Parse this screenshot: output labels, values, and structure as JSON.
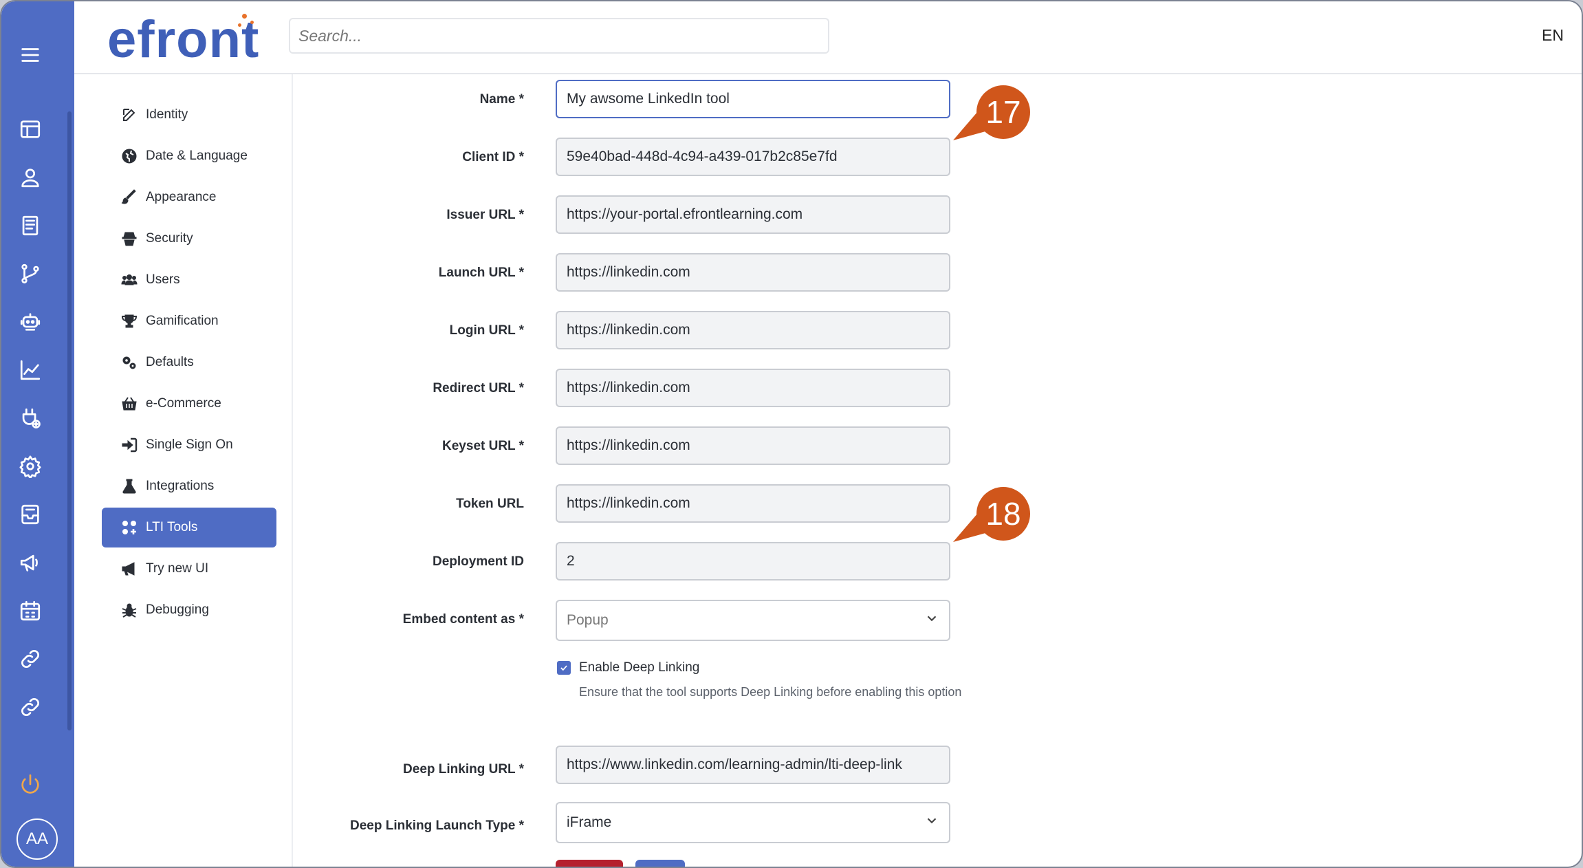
{
  "header": {
    "logo_text": "efront",
    "search_placeholder": "Search...",
    "language": "EN"
  },
  "user": {
    "initials": "AA"
  },
  "rail_icons": [
    "menu-icon",
    "dashboard-icon",
    "user-icon",
    "courses-icon",
    "branches-icon",
    "robot-icon",
    "reports-icon",
    "plugin-icon",
    "settings-icon",
    "messages-icon",
    "announcements-icon",
    "calendar-icon",
    "link-icon",
    "link-icon",
    "power-icon"
  ],
  "sidebar": {
    "items": [
      {
        "label": "Identity",
        "icon": "edit-icon"
      },
      {
        "label": "Date & Language",
        "icon": "globe-icon"
      },
      {
        "label": "Appearance",
        "icon": "brush-icon"
      },
      {
        "label": "Security",
        "icon": "spy-icon"
      },
      {
        "label": "Users",
        "icon": "users-icon"
      },
      {
        "label": "Gamification",
        "icon": "trophy-icon"
      },
      {
        "label": "Defaults",
        "icon": "cogs-icon"
      },
      {
        "label": "e-Commerce",
        "icon": "basket-icon"
      },
      {
        "label": "Single Sign On",
        "icon": "sign-in-icon"
      },
      {
        "label": "Integrations",
        "icon": "flask-icon"
      },
      {
        "label": "LTI Tools",
        "icon": "lti-icon"
      },
      {
        "label": "Try new UI",
        "icon": "megaphone-icon"
      },
      {
        "label": "Debugging",
        "icon": "bug-icon"
      }
    ],
    "active": "LTI Tools"
  },
  "form": {
    "name": {
      "label": "Name *",
      "value": "My awsome LinkedIn tool"
    },
    "client_id": {
      "label": "Client ID *",
      "value": "59e40bad-448d-4c94-a439-017b2c85e7fd"
    },
    "issuer_url": {
      "label": "Issuer URL *",
      "value": "https://your-portal.efrontlearning.com"
    },
    "launch_url": {
      "label": "Launch URL *",
      "value": "https://linkedin.com"
    },
    "login_url": {
      "label": "Login URL *",
      "value": "https://linkedin.com"
    },
    "redirect_url": {
      "label": "Redirect URL *",
      "value": "https://linkedin.com"
    },
    "keyset_url": {
      "label": "Keyset URL *",
      "value": "https://linkedin.com"
    },
    "token_url": {
      "label": "Token URL",
      "value": "https://linkedin.com"
    },
    "deployment_id": {
      "label": "Deployment ID",
      "value": "2"
    },
    "embed_content": {
      "label": "Embed content as *",
      "value": "Popup"
    },
    "deep_linking": {
      "label": "Enable Deep Linking",
      "checked": true,
      "hint": "Ensure that the tool supports Deep Linking before enabling this option"
    },
    "deep_linking_url": {
      "label": "Deep Linking URL *",
      "value": "https://www.linkedin.com/learning-admin/lti-deep-link"
    },
    "deep_linking_launch_type": {
      "label": "Deep Linking Launch Type *",
      "value": "iFrame"
    }
  },
  "callouts": [
    "17",
    "18"
  ],
  "colors": {
    "primary": "#4f6cc4",
    "accent": "#e8722a",
    "callout": "#d0561b",
    "danger": "#b5202e"
  }
}
